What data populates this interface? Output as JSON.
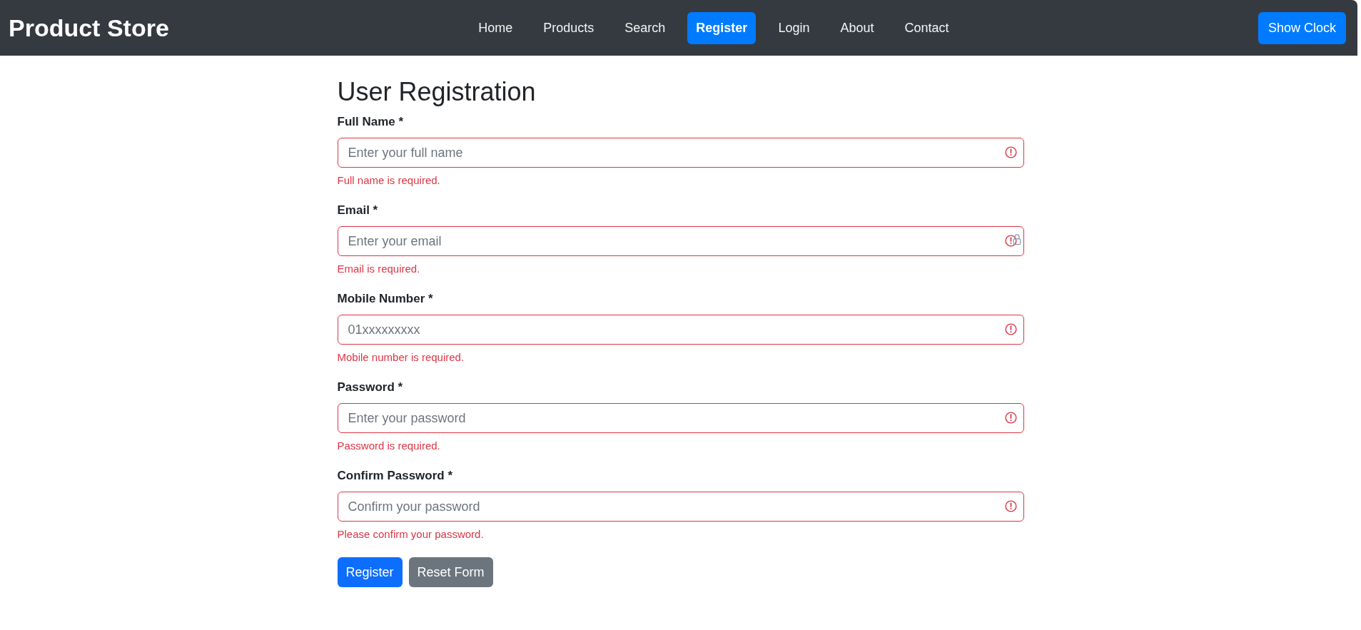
{
  "navbar": {
    "brand": "Product Store",
    "links": [
      {
        "label": "Home",
        "selected": false
      },
      {
        "label": "Products",
        "selected": false
      },
      {
        "label": "Search",
        "selected": false
      },
      {
        "label": "Register",
        "selected": true
      },
      {
        "label": "Login",
        "selected": false
      },
      {
        "label": "About",
        "selected": false
      },
      {
        "label": "Contact",
        "selected": false
      }
    ],
    "clock_button": "Show Clock"
  },
  "form": {
    "title": "User Registration",
    "fields": [
      {
        "label": "Full Name *",
        "placeholder": "Enter your full name",
        "invalid": true,
        "error": "Full name is required.",
        "autofill_icon": false
      },
      {
        "label": "Email *",
        "placeholder": "Enter your email",
        "invalid": true,
        "error": "Email is required.",
        "autofill_icon": true
      },
      {
        "label": "Mobile Number *",
        "placeholder": "01xxxxxxxxx",
        "invalid": true,
        "error": "Mobile number is required.",
        "autofill_icon": false
      },
      {
        "label": "Password *",
        "placeholder": "Enter your password",
        "invalid": true,
        "error": "Password is required.",
        "autofill_icon": false
      },
      {
        "label": "Confirm Password *",
        "placeholder": "Confirm your password",
        "invalid": true,
        "error": "Please confirm your password.",
        "autofill_icon": false
      }
    ],
    "buttons": [
      {
        "label": "Register",
        "kind": "primary"
      },
      {
        "label": "Reset Form",
        "kind": "secondary"
      }
    ]
  }
}
